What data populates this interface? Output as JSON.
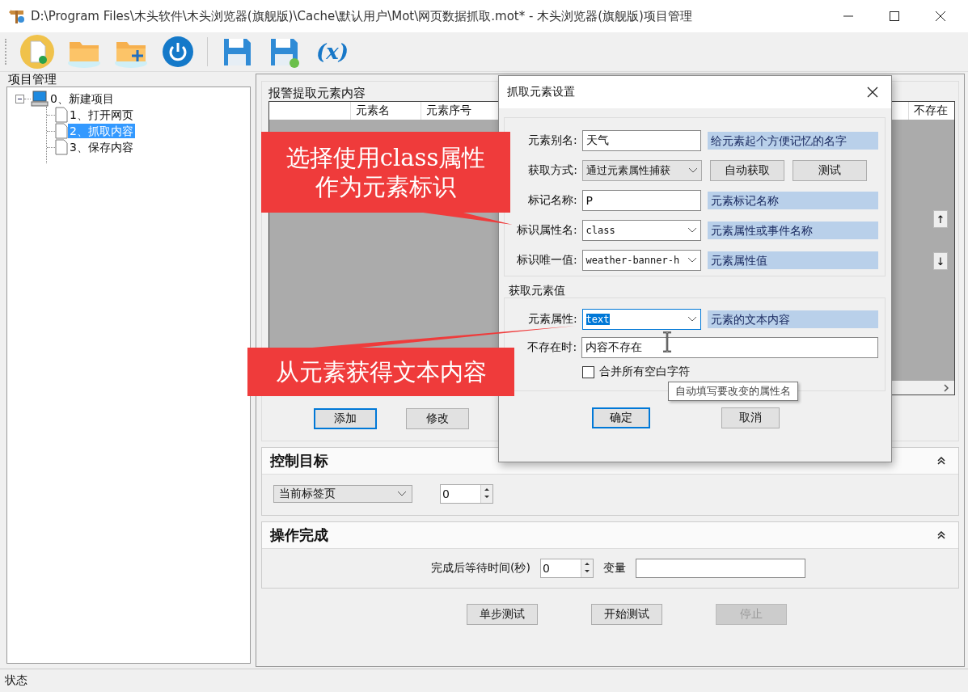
{
  "window": {
    "title": "D:\\Program Files\\木头软件\\木头浏览器(旗舰版)\\Cache\\默认用户\\Mot\\网页数据抓取.mot* - 木头浏览器(旗舰版)项目管理"
  },
  "toolbar": [
    {
      "kind": "new"
    },
    {
      "kind": "open"
    },
    {
      "kind": "add-folder"
    },
    {
      "kind": "power"
    },
    {
      "kind": "separator"
    },
    {
      "kind": "save"
    },
    {
      "kind": "save-as"
    },
    {
      "kind": "variable",
      "label": "(x)"
    }
  ],
  "project_panel": {
    "title": "项目管理",
    "tree": [
      {
        "label": "0、新建项目",
        "expanded": true,
        "selected": false,
        "children": [
          {
            "label": "1、打开网页",
            "selected": false
          },
          {
            "label": "2、抓取内容",
            "selected": true
          },
          {
            "label": "3、保存内容",
            "selected": false
          }
        ]
      }
    ]
  },
  "grid_section": {
    "title": "报警提取元素内容",
    "columns": [
      "元素名",
      "元素序号",
      "不存在"
    ],
    "move_buttons": [
      "↑",
      "↓"
    ],
    "buttons": [
      {
        "label": "添加",
        "focused": true
      },
      {
        "label": "修改",
        "focused": false
      }
    ]
  },
  "control_target": {
    "title": "控制目标",
    "dropdown": "当前标签页",
    "spin_value": "0"
  },
  "completion": {
    "title": "操作完成",
    "wait_label": "完成后等待时间(秒)",
    "wait_value": "0",
    "variable_label": "变量"
  },
  "actions": [
    {
      "label": "单步测试",
      "disabled": false
    },
    {
      "label": "开始测试",
      "disabled": false
    },
    {
      "label": "停止",
      "disabled": true
    }
  ],
  "status_bar": "状态",
  "dialog": {
    "title": "抓取元素设置",
    "rows": [
      {
        "kind": "input",
        "label": "元素别名:",
        "value": "天气",
        "hint": "给元素起个方便记忆的名字"
      },
      {
        "kind": "select-buttons",
        "label": "获取方式:",
        "value": "通过元素属性捕获",
        "buttons": [
          "自动获取",
          "测试"
        ]
      },
      {
        "kind": "input",
        "label": "标记名称:",
        "value": "P",
        "hint": "元素标记名称"
      },
      {
        "kind": "combo",
        "label": "标识属性名:",
        "value": "class",
        "hint": "元素属性或事件名称"
      },
      {
        "kind": "combo",
        "label": "标识唯一值:",
        "value": "weather-banner-h",
        "hint": "元素属性值"
      }
    ],
    "value_group": {
      "title": "获取元素值",
      "rows": [
        {
          "kind": "combo",
          "label": "元素属性:",
          "value": "text",
          "selected": true,
          "hint": "元素的文本内容"
        },
        {
          "kind": "wide-input",
          "label": "不存在时:",
          "value": "内容不存在"
        }
      ],
      "checkbox": {
        "label": "合并所有空白字符",
        "checked": false
      }
    },
    "tooltip": "自动填写要改变的属性名",
    "buttons": [
      {
        "label": "确定",
        "focused": true
      },
      {
        "label": "取消",
        "focused": false
      }
    ]
  },
  "callouts": [
    {
      "lines": [
        "选择使用class属性",
        "作为元素标识"
      ]
    },
    {
      "lines": [
        "从元素获得文本内容"
      ]
    }
  ]
}
